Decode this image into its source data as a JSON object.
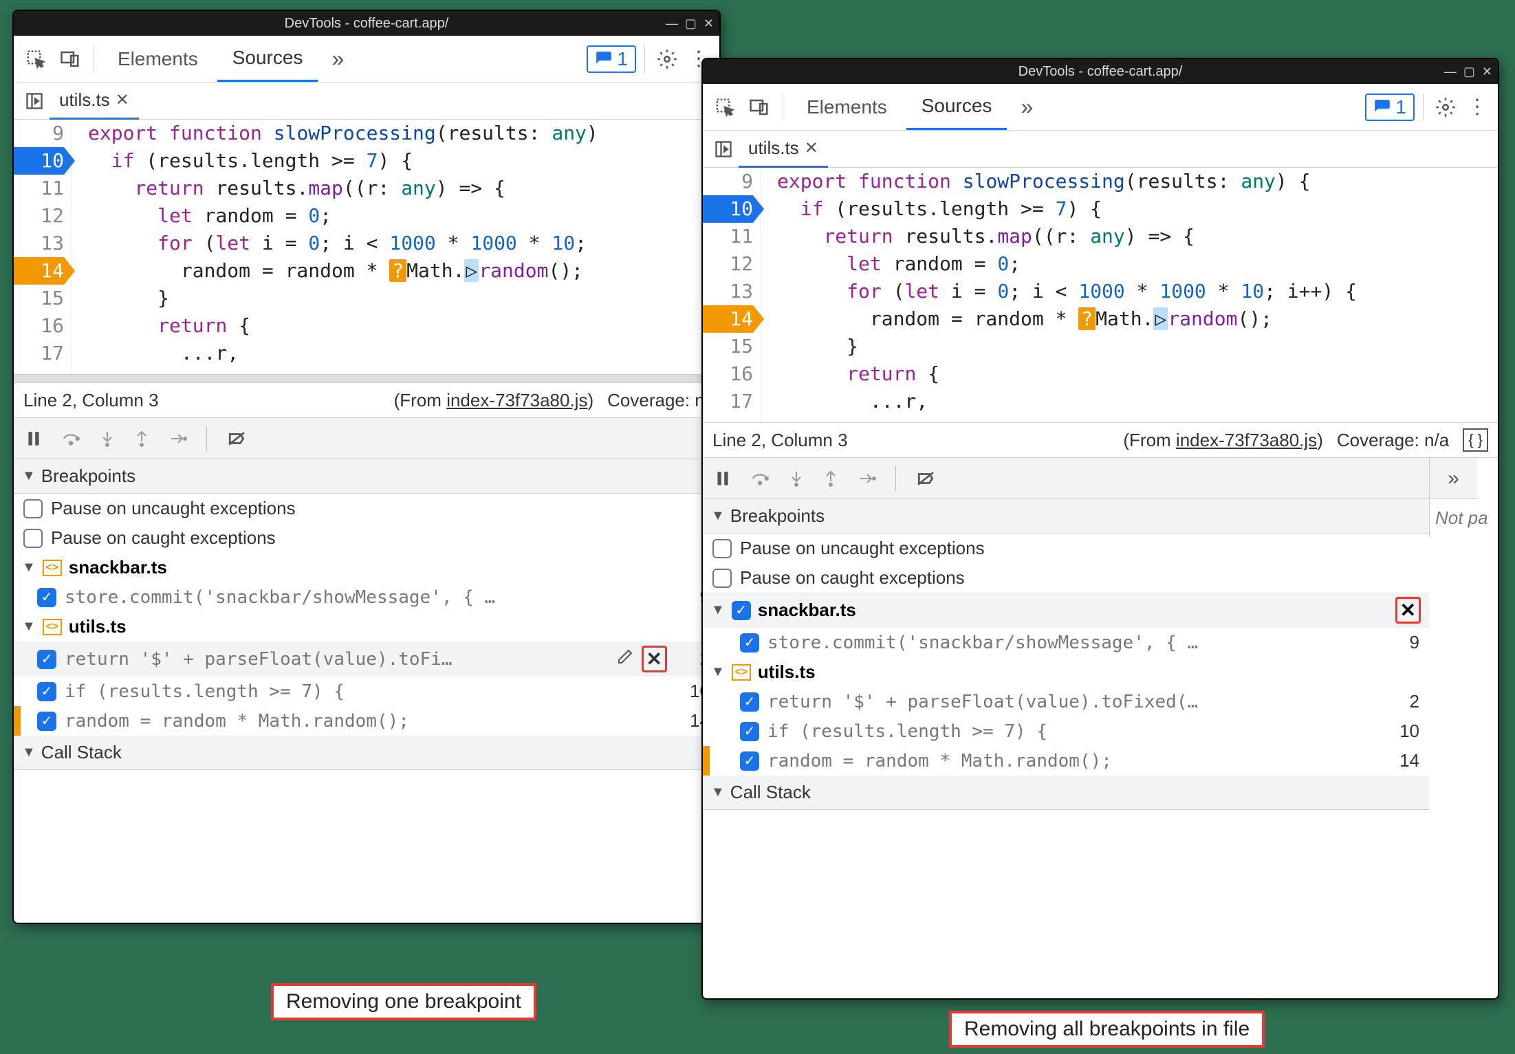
{
  "window": {
    "title": "DevTools - coffee-cart.app/"
  },
  "toolbar": {
    "tabs": {
      "elements": "Elements",
      "sources": "Sources"
    },
    "issues_count": "1"
  },
  "file": {
    "name": "utils.ts"
  },
  "code": {
    "lines": [
      "9",
      "10",
      "11",
      "12",
      "13",
      "14",
      "15",
      "16",
      "17"
    ]
  },
  "status": {
    "pos": "Line 2, Column 3",
    "from_prefix": "(From ",
    "from_link": "index-73f73a80.js",
    "from_suffix": ")",
    "coverage_short": "Coverage: n/",
    "coverage_long": "Coverage: n/a"
  },
  "sections": {
    "breakpoints": "Breakpoints",
    "callstack": "Call Stack"
  },
  "options": {
    "uncaught": "Pause on uncaught exceptions",
    "caught": "Pause on caught exceptions"
  },
  "groups": {
    "snackbar": {
      "name": "snackbar.ts",
      "items": [
        {
          "code": "store.commit('snackbar/showMessage', { …",
          "line": "9"
        }
      ]
    },
    "utils": {
      "name": "utils.ts",
      "items": [
        {
          "code_short": "return '$' + parseFloat(value).toFi…",
          "code_long": "return '$' + parseFloat(value).toFixed(…",
          "line": "2"
        },
        {
          "code": "if (results.length >= 7) {",
          "line": "10"
        },
        {
          "code": "random = random * Math.random();",
          "line": "14"
        }
      ]
    }
  },
  "side": {
    "notpa": "Not pa"
  },
  "captions": {
    "left": "Removing one breakpoint",
    "right": "Removing all breakpoints in file"
  }
}
